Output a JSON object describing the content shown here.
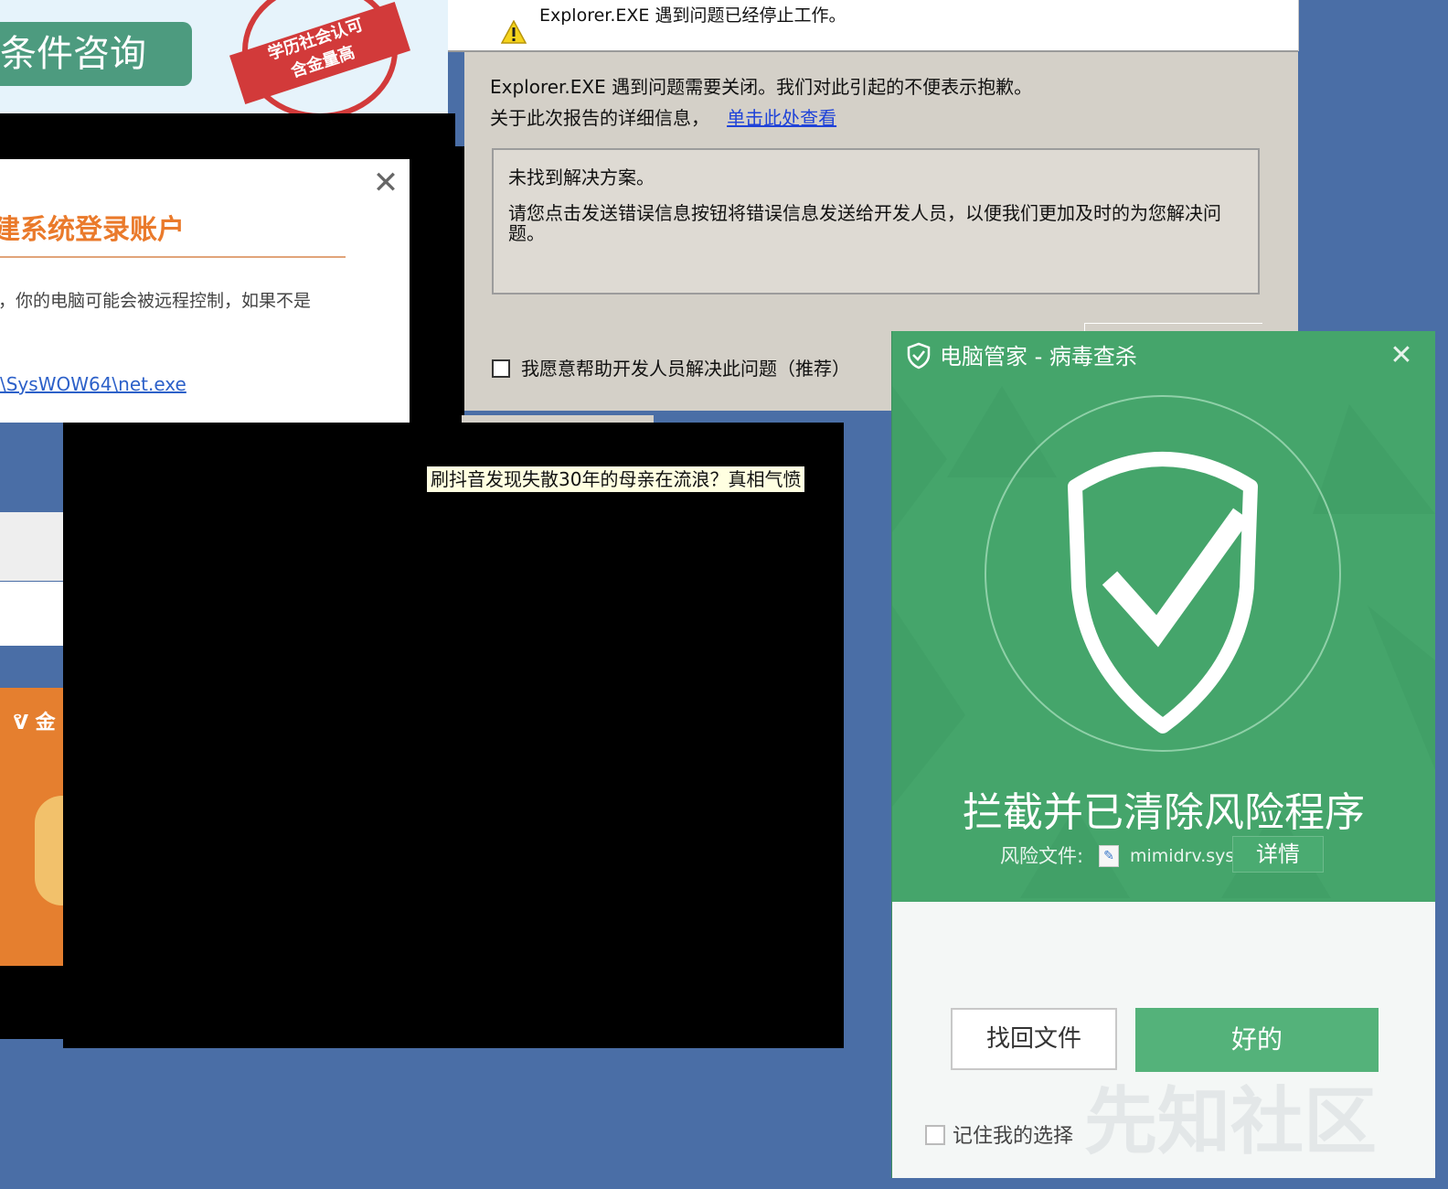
{
  "ad": {
    "consult_label": "条件咨询",
    "stamp_line1": "学历社会认可",
    "stamp_line2": "含金量高"
  },
  "login_dialog": {
    "title": "建系统登录账户",
    "message": "，你的电脑可能会被远程控制，如果不是",
    "path": "\\SysWOW64\\net.exe",
    "close_label": "✕"
  },
  "orange_ad": {
    "brand": "ᕓ 金"
  },
  "error_dialog": {
    "title": "Explorer.EXE 遇到问题已经停止工作。",
    "line1": "Explorer.EXE 遇到问题需要关闭。我们对此引起的不便表示抱歉。",
    "line2_prefix": "关于此次报告的详细信息，",
    "line2_link": "单击此处查看",
    "box_heading": "未找到解决方案。",
    "box_text": "请您点击发送错误信息按钮将错误信息发送给开发人员，以便我们更加及时的为您解决问题。",
    "checkbox_label": "我愿意帮助开发人员解决此问题（推荐）"
  },
  "headline_tooltip": "刷抖音发现失散30年的母亲在流浪？真相气愤",
  "pc_manager": {
    "title": "电脑管家 - 病毒查杀",
    "close_label": "✕",
    "headline": "拦截并已清除风险程序",
    "risk_label": "风险文件:",
    "file_name": "mimidrv.sys",
    "details_label": "详情",
    "recover_label": "找回文件",
    "ok_label": "好的",
    "remember_label": "记住我的选择",
    "watermark": "先知社区",
    "theme_color": "#45a56b"
  }
}
